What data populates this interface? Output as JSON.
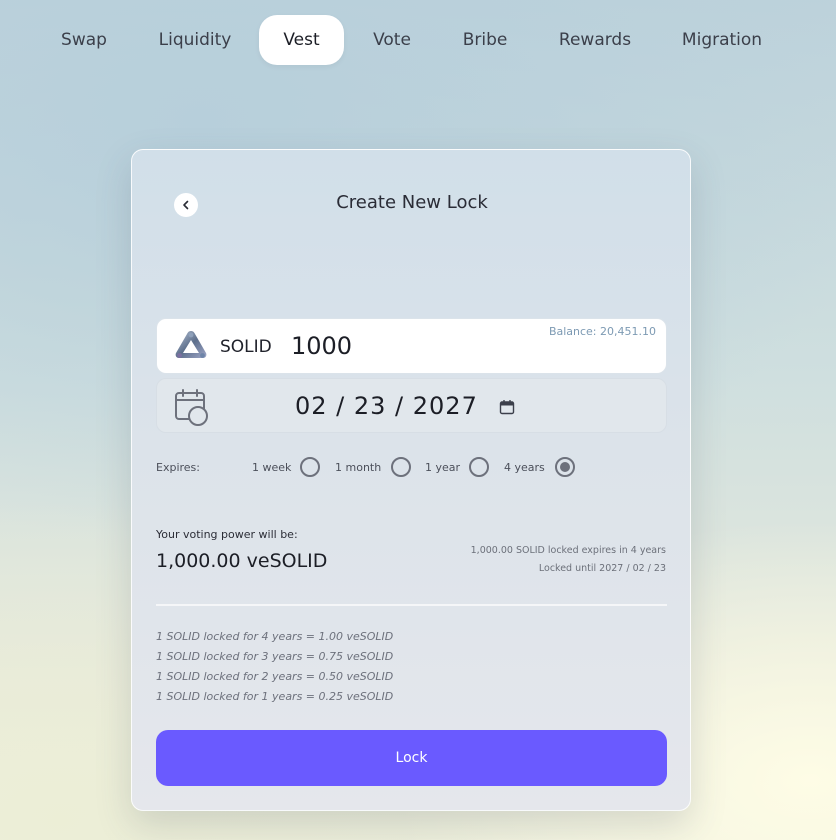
{
  "nav": {
    "tabs": [
      {
        "label": "Swap"
      },
      {
        "label": "Liquidity"
      },
      {
        "label": "Vest"
      },
      {
        "label": "Vote"
      },
      {
        "label": "Bribe"
      },
      {
        "label": "Rewards"
      },
      {
        "label": "Migration"
      }
    ],
    "active": "Vest"
  },
  "card": {
    "title": "Create New Lock",
    "token": {
      "symbol": "SOLID",
      "amount": "1000",
      "balance": "Balance: 20,451.10"
    },
    "date": {
      "value": "02 / 23 / 2027"
    },
    "expires": {
      "label": "Expires:",
      "options": [
        {
          "label": "1 week",
          "selected": false
        },
        {
          "label": "1 month",
          "selected": false
        },
        {
          "label": "1 year",
          "selected": false
        },
        {
          "label": "4 years",
          "selected": true
        }
      ]
    },
    "voting_power": {
      "label": "Your voting power will be:",
      "value": "1,000.00 veSOLID",
      "expires_note": "1,000.00 SOLID locked expires in 4 years",
      "locked_until": "Locked until 2027 / 02 / 23"
    },
    "rates": [
      "1 SOLID locked for 4 years = 1.00 veSOLID",
      "1 SOLID locked for 3 years = 0.75 veSOLID",
      "1 SOLID locked for 2 years = 0.50 veSOLID",
      "1 SOLID locked for 1 years = 0.25 veSOLID"
    ],
    "lock_button": "Lock"
  },
  "colors": {
    "accent": "#6a5aff",
    "balance_text": "#7d9ab3"
  }
}
